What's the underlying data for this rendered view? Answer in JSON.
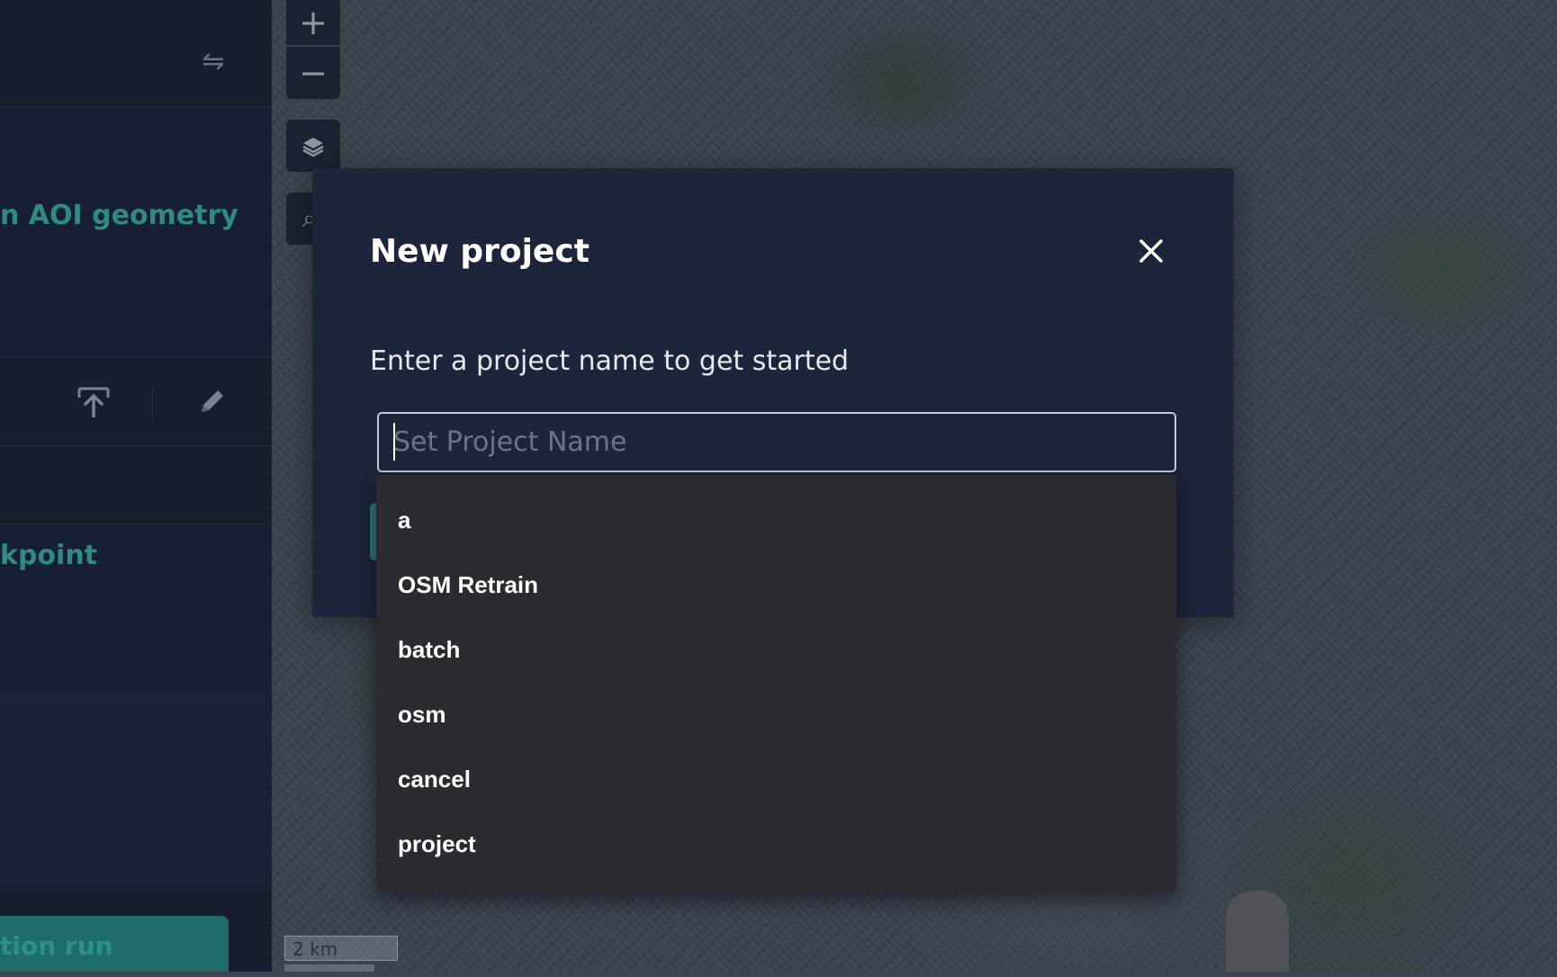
{
  "sidebar": {
    "aoi_label": "n AOI geometry",
    "checkpoint_label": "kpoint",
    "run_button_label": "tion run"
  },
  "map": {
    "zoom_in": "+",
    "zoom_out": "−",
    "scale_label": "2 km"
  },
  "modal": {
    "title": "New project",
    "subtitle": "Enter a project name to get started",
    "input_placeholder": "Set Project Name",
    "input_value": ""
  },
  "autocomplete": {
    "options": [
      "a",
      "OSM Retrain",
      "batch",
      "osm",
      "cancel",
      "project"
    ]
  },
  "colors": {
    "sidebar_bg": "#161d2c",
    "modal_bg": "#1c2539",
    "accent_teal": "#2f8a86",
    "dropdown_bg": "#2a2b30"
  }
}
